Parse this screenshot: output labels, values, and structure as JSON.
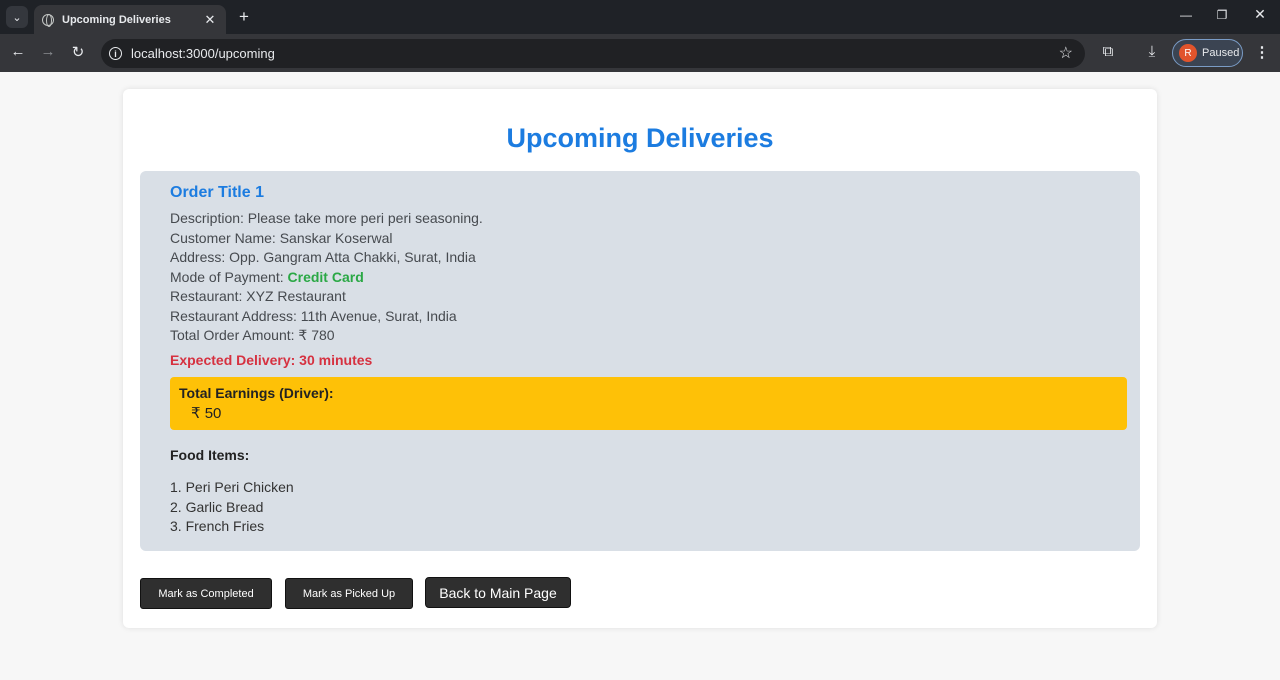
{
  "browser": {
    "tab_title": "Upcoming Deliveries",
    "url": "localhost:3000/upcoming",
    "profile_initial": "R",
    "profile_label": "Paused",
    "icons": {
      "tab_search": "⌄",
      "tab_close": "✕",
      "new_tab": "+",
      "minimize": "—",
      "maximize": "❐",
      "close": "✕",
      "back": "←",
      "forward": "→",
      "reload": "↻",
      "info": "i",
      "star": "☆",
      "extensions": "⧉",
      "download": "⤓",
      "menu": "⋮"
    }
  },
  "page": {
    "title": "Upcoming Deliveries",
    "order": {
      "title": "Order Title 1",
      "description": "Description: Please take more peri peri seasoning.",
      "customer": "Customer Name: Sanskar Koserwal",
      "address": "Address: Opp. Gangram Atta Chakki, Surat, India",
      "payment_label": "Mode of Payment: ",
      "payment_value": "Credit Card",
      "restaurant": "Restaurant: XYZ Restaurant",
      "restaurant_address": "Restaurant Address: 11th Avenue, Surat, India",
      "total_amount": "Total Order Amount: ₹ 780",
      "expected_delivery": "Expected Delivery: 30 minutes",
      "earnings_label": "Total Earnings (Driver):",
      "earnings_value": "₹ 50",
      "food_label": "Food Items:",
      "food_items": [
        "1. Peri Peri Chicken",
        "2. Garlic Bread",
        "3. French Fries"
      ]
    },
    "buttons": {
      "complete": "Mark as Completed",
      "picked_up": "Mark as Picked Up",
      "back": "Back to Main Page"
    }
  },
  "colors": {
    "title_blue": "#1c7ce0",
    "payment_green": "#2aa845",
    "expected_red": "#d63140",
    "earnings_yellow": "#fec107",
    "order_bg": "#d9dfe6"
  }
}
